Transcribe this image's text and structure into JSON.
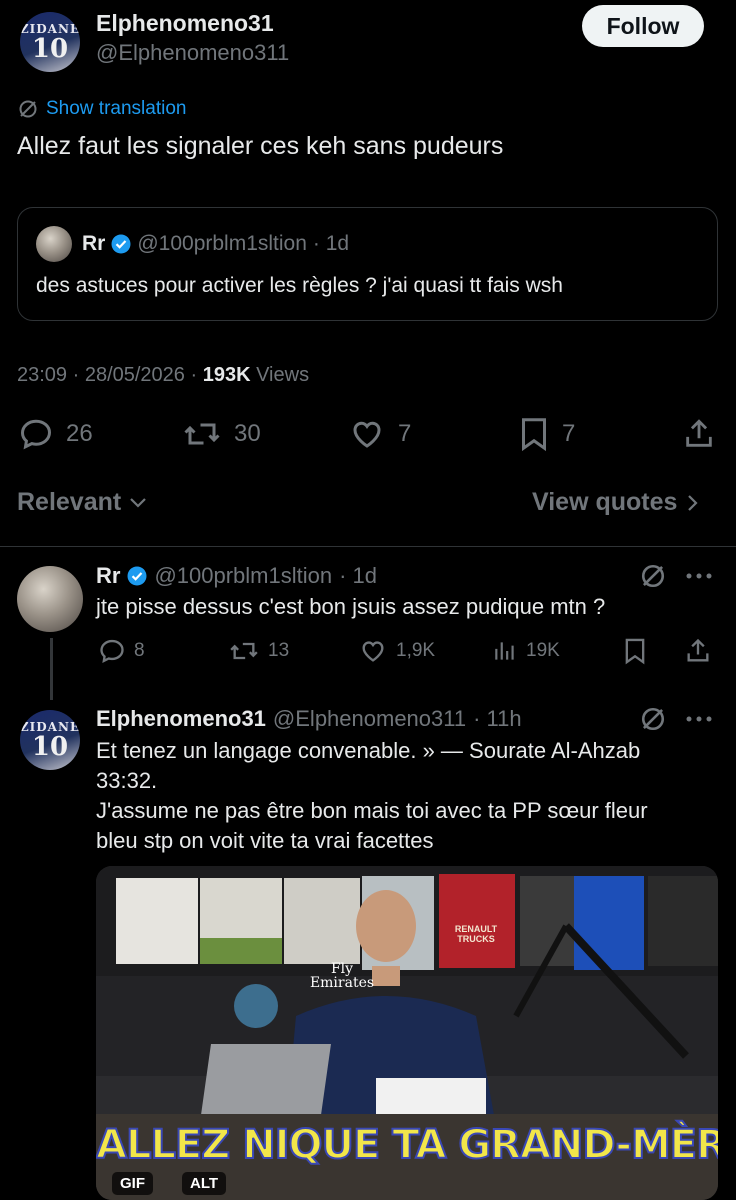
{
  "main_tweet": {
    "display_name": "Elphenomeno31",
    "handle": "@Elphenomeno311",
    "avatar_text": "ZIDANE",
    "avatar_number": "10",
    "follow_label": "Follow",
    "show_translation": "Show translation",
    "text": "Allez faut les signaler ces keh sans pudeurs",
    "quoted": {
      "display_name": "Rr",
      "handle": "@100prblm1sltion",
      "time": "· 1d",
      "text": "des astuces pour activer les règles ? j'ai quasi tt fais wsh"
    },
    "timestamp": "23:09 · 28/05/2026 ·",
    "views_count": "193K",
    "views_label": "Views",
    "replies": "26",
    "reposts": "30",
    "likes": "7",
    "bookmarks": "7"
  },
  "sort": {
    "relevant_label": "Relevant",
    "view_quotes_label": "View quotes"
  },
  "reply1": {
    "display_name": "Rr",
    "handle": "@100prblm1sltion",
    "time": "· 1d",
    "text": "jte pisse dessus c'est bon jsuis assez pudique mtn ?",
    "replies": "8",
    "reposts": "13",
    "likes": "1,9K",
    "views": "19K"
  },
  "reply2": {
    "display_name": "Elphenomeno31",
    "handle": "@Elphenomeno311",
    "time": "· 11h",
    "avatar_text": "ZIDANE",
    "avatar_number": "10",
    "text_line1": "Et tenez un langage convenable. » — Sourate Al-Ahzab",
    "text_line2": "33:32.",
    "text_line3": "J'assume ne pas être bon mais toi avec ta PP sœur fleur",
    "text_line4": "bleu stp on voit vite ta vrai facettes",
    "gif_caption": "ALLEZ NIQUE TA GRAND-MÈRE !",
    "gif_badge": "GIF",
    "alt_badge": "ALT",
    "gif_jersey_text1": "Fly",
    "gif_jersey_text2": "Emirates",
    "gif_shirt_text": "RENAULT TRUCKS"
  },
  "colors": {
    "background": "#000000",
    "text": "#e7e9ea",
    "muted": "#71767b",
    "accent_blue": "#1d9bf0",
    "border": "#2f3336"
  }
}
